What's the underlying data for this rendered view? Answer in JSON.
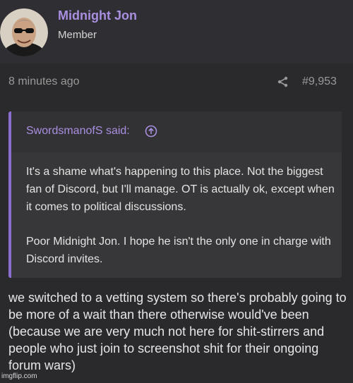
{
  "user": {
    "name": "Midnight Jon",
    "title": "Member"
  },
  "post": {
    "time": "8 minutes ago",
    "number": "#9,953",
    "quote": {
      "author_said": "SwordsmanofS said:",
      "paragraphs": [
        "It's a shame what's happening to this place. Not the biggest fan of Discord, but I'll manage. OT is actually ok, except when it comes to political discussions.",
        "Poor Midnight Jon. I hope he isn't the only one in charge with Discord invites."
      ]
    },
    "body": "we switched to a vetting system so there's probably going to be more of a wait than there otherwise would've been (because we are very much not here for shit-stirrers and people who just join to screenshot shit for their ongoing forum wars)"
  },
  "watermark": "imgflip.com",
  "colors": {
    "background": "#2a2a2d",
    "accent": "#a98fe0",
    "quote_border": "#8b6fd0"
  },
  "icons": {
    "share": "share-icon",
    "quote_jump": "arrow-up-circle-icon"
  }
}
